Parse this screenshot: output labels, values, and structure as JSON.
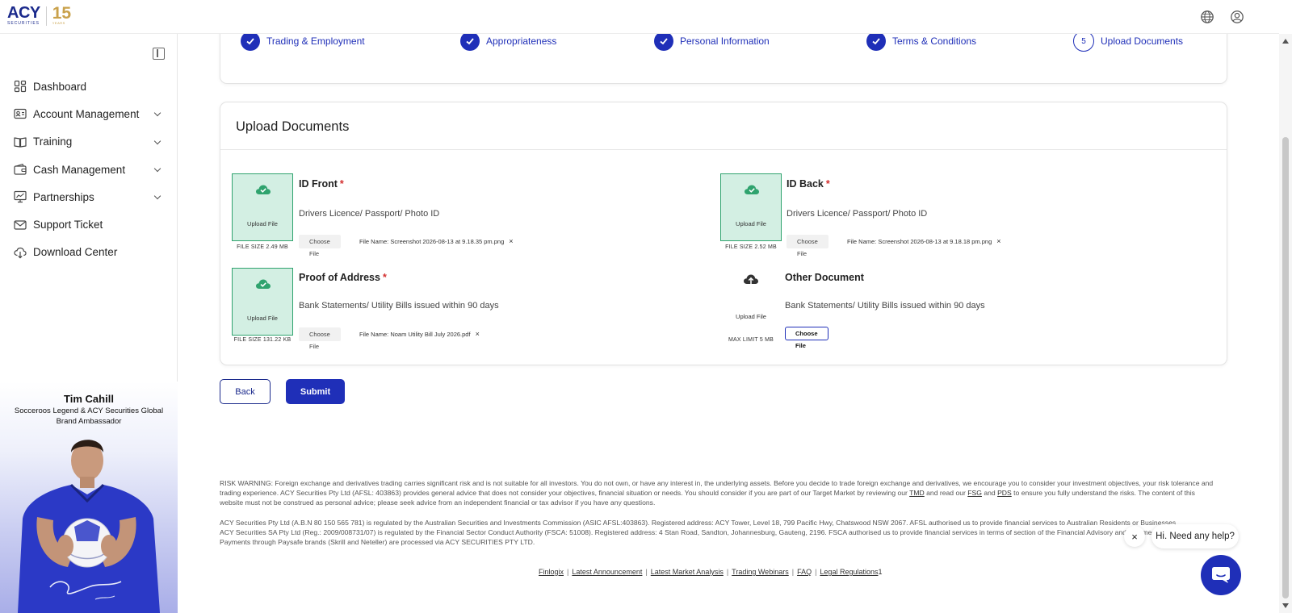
{
  "header": {
    "logo_text": "ACY",
    "logo_sub": "SECURITIES",
    "logo_badge": "15",
    "logo_badge_sub": "YEARS"
  },
  "sidebar": {
    "items": [
      {
        "label": "Dashboard",
        "icon": "dashboard-icon",
        "expandable": false
      },
      {
        "label": "Account Management",
        "icon": "account-card-icon",
        "expandable": true
      },
      {
        "label": "Training",
        "icon": "book-icon",
        "expandable": true
      },
      {
        "label": "Cash Management",
        "icon": "wallet-icon",
        "expandable": true
      },
      {
        "label": "Partnerships",
        "icon": "chart-icon",
        "expandable": true
      },
      {
        "label": "Support Ticket",
        "icon": "mail-icon",
        "expandable": false
      },
      {
        "label": "Download Center",
        "icon": "cloud-download-icon",
        "expandable": false
      }
    ],
    "ambassador": {
      "name": "Tim Cahill",
      "title": "Socceroos Legend & ACY Securities Global Brand Ambassador"
    }
  },
  "stepper": {
    "steps": [
      {
        "label": "Trading & Employment",
        "done": true
      },
      {
        "label": "Appropriateness",
        "done": true
      },
      {
        "label": "Personal Information",
        "done": true
      },
      {
        "label": "Terms & Conditions",
        "done": true
      },
      {
        "label": "Upload Documents",
        "done": false,
        "number": "5"
      }
    ]
  },
  "upload": {
    "title": "Upload Documents",
    "upload_file_label": "Upload File",
    "choose_file_label": "Choose File",
    "documents": {
      "id_front": {
        "title": "ID Front",
        "required_mark": "*",
        "desc": "Drivers Licence/ Passport/ Photo ID",
        "size": "FILE SIZE 2.49 MB",
        "file_name": "File Name: Screenshot 2026-08-13 at 9.18.35 pm.png",
        "remove": "×"
      },
      "id_back": {
        "title": "ID Back",
        "required_mark": "*",
        "desc": "Drivers Licence/ Passport/ Photo ID",
        "size": "FILE SIZE 2.52 MB",
        "file_name": "File Name: Screenshot 2026-08-13 at 9.18.18 pm.png",
        "remove": "×"
      },
      "proof_address": {
        "title": "Proof of Address",
        "required_mark": "*",
        "desc": "Bank Statements/ Utility Bills issued within 90 days",
        "size": "FILE SIZE 131.22 KB",
        "file_name": "File Name: Noam Utility Bill July 2026.pdf",
        "remove": "×"
      },
      "other": {
        "title": "Other Document",
        "desc": "Bank Statements/ Utility Bills issued within 90 days",
        "size": "MAX LIMIT 5 MB"
      }
    }
  },
  "actions": {
    "back": "Back",
    "submit": "Submit"
  },
  "disclaimer": {
    "risk_a": "RISK WARNING: Foreign exchange and derivatives trading carries significant risk and is not suitable for all investors. You do not own, or have any interest in, the underlying assets. Before you decide to trade foreign exchange and derivatives, we encourage you to consider your investment objectives, your risk tolerance and trading experience. ACY Securities Pty Ltd (AFSL: 403863) provides general advice that does not consider your objectives, financial situation or needs. You should consider if you are part of our Target Market by reviewing our ",
    "tmd": "TMD",
    "risk_b": " and read our ",
    "fsg": "FSG",
    "risk_c": " and ",
    "pds": "PDS",
    "risk_d": " to ensure you fully understand the risks. The content of this website must not be construed as personal advice; please seek advice from an independent financial or tax advisor if you have any questions.",
    "au_reg": "ACY Securities Pty Ltd (A.B.N 80 150 565 781) is regulated by the Australian Securities and Investments Commission (ASIC AFSL:403863). Registered address: ACY Tower, Level 18, 799 Pacific Hwy, Chatswood NSW 2067. AFSL authorised us to provide financial services to Australian Residents or Businesses.",
    "sa_reg": "ACY Securities SA Pty Ltd (Reg.: 2009/008731/07) is regulated by the Financial Sector Conduct Authority (FSCA: 51008). Registered address: 4 Stan Road, Sandton, Johannesburg, Gauteng, 2196. FSCA authorised us to provide financial services in terms of section of the Financial Advisory and Intermediary Services.",
    "paysafe": "Payments through Paysafe brands (Skrill and Neteller) are processed via ACY SECURITIES PTY LTD."
  },
  "footer": {
    "links": [
      "Finlogix",
      "Latest Announcement",
      "Latest Market Analysis",
      "Trading Webinars",
      "FAQ",
      "Legal Regulations"
    ],
    "separator": "|",
    "suffix": "1"
  },
  "chat": {
    "prompt": "Hi. Need any help?",
    "close": "×"
  },
  "colors": {
    "brand": "#1f2fb8",
    "upload_success_bg": "#d3efe3",
    "upload_success_border": "#2fa36e",
    "required": "#d32f2f"
  }
}
